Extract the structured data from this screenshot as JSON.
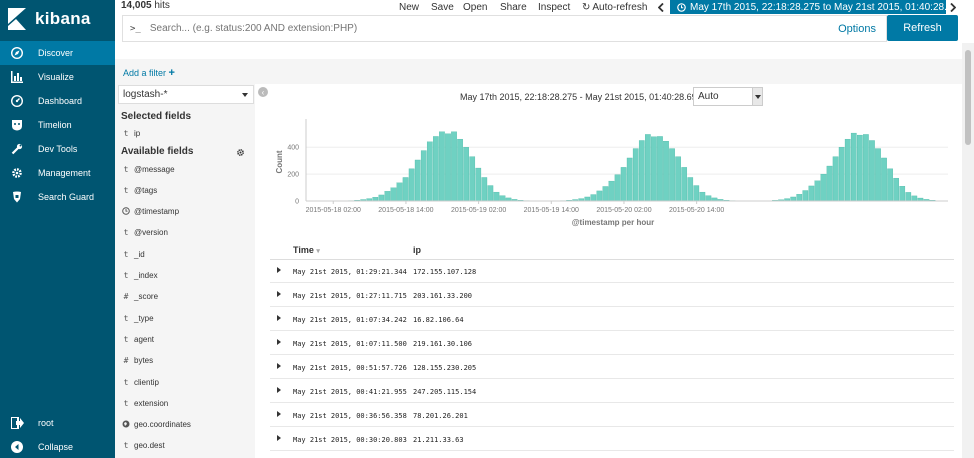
{
  "app": {
    "name": "kibana"
  },
  "colors": {
    "sidebar": "#005571",
    "accent": "#0079a5",
    "bar": "#6fd1c2"
  },
  "sidebar": {
    "items": [
      {
        "label": "Discover",
        "icon": "compass-icon",
        "active": true
      },
      {
        "label": "Visualize",
        "icon": "bar-chart-icon"
      },
      {
        "label": "Dashboard",
        "icon": "dashboard-icon"
      },
      {
        "label": "Timelion",
        "icon": "timelion-icon"
      },
      {
        "label": "Dev Tools",
        "icon": "wrench-icon"
      },
      {
        "label": "Management",
        "icon": "gear-icon"
      },
      {
        "label": "Search Guard",
        "icon": "search-guard-icon"
      }
    ],
    "bottom": [
      {
        "label": "root",
        "icon": "logout-icon"
      },
      {
        "label": "Collapse",
        "icon": "collapse-icon"
      }
    ]
  },
  "topbar": {
    "hits_count": "14,005",
    "hits_label": " hits",
    "menu": {
      "new": "New",
      "save": "Save",
      "open": "Open",
      "share": "Share",
      "inspect": "Inspect",
      "auto_refresh": "Auto-refresh"
    },
    "time_range": "May 17th 2015, 22:18:28.275 to May 21st 2015, 01:40:28.697"
  },
  "query": {
    "prompt": ">_",
    "placeholder": "Search... (e.g. status:200 AND extension:PHP)",
    "options": "Options",
    "refresh": "Refresh"
  },
  "filters": {
    "add": "Add a filter"
  },
  "fields": {
    "index_pattern": "logstash-*",
    "selected_title": "Selected fields",
    "selected": [
      {
        "type": "t",
        "name": "ip"
      }
    ],
    "available_title": "Available fields",
    "available": [
      {
        "type": "t",
        "name": "@message"
      },
      {
        "type": "t",
        "name": "@tags"
      },
      {
        "type": "clock",
        "name": "@timestamp"
      },
      {
        "type": "t",
        "name": "@version"
      },
      {
        "type": "t",
        "name": "_id"
      },
      {
        "type": "t",
        "name": "_index"
      },
      {
        "type": "#",
        "name": "_score"
      },
      {
        "type": "t",
        "name": "_type"
      },
      {
        "type": "t",
        "name": "agent"
      },
      {
        "type": "#",
        "name": "bytes"
      },
      {
        "type": "t",
        "name": "clientip"
      },
      {
        "type": "t",
        "name": "extension"
      },
      {
        "type": "geo",
        "name": "geo.coordinates"
      },
      {
        "type": "t",
        "name": "geo.dest"
      }
    ]
  },
  "histogram": {
    "range_text": "May 17th 2015, 22:18:28.275 - May 21st 2015, 01:40:28.697 —",
    "interval": "Auto"
  },
  "chart_data": {
    "type": "bar",
    "xlabel": "@timestamp per hour",
    "ylabel": "Count",
    "ylim": [
      0,
      580
    ],
    "yticks": [
      0,
      200,
      400
    ],
    "xticks": [
      "2015-05-18 02:00",
      "2015-05-18 14:00",
      "2015-05-19 02:00",
      "2015-05-19 14:00",
      "2015-05-20 02:00",
      "2015-05-20 14:00"
    ],
    "xticks_hour_index": [
      4,
      16,
      28,
      40,
      52,
      64
    ],
    "values": [
      0,
      0,
      0,
      0,
      0,
      0,
      1,
      3,
      6,
      11,
      18,
      28,
      45,
      72,
      98,
      135,
      175,
      240,
      305,
      375,
      440,
      480,
      515,
      500,
      515,
      460,
      400,
      330,
      245,
      175,
      115,
      66,
      40,
      23,
      12,
      6,
      3,
      1,
      0,
      0,
      0,
      1,
      3,
      6,
      11,
      18,
      30,
      48,
      75,
      108,
      148,
      196,
      250,
      320,
      390,
      450,
      495,
      478,
      480,
      445,
      390,
      330,
      250,
      175,
      115,
      66,
      40,
      23,
      12,
      6,
      3,
      1,
      0,
      0,
      0,
      1,
      2,
      5,
      10,
      18,
      30,
      50,
      78,
      112,
      150,
      200,
      260,
      330,
      400,
      460,
      505,
      490,
      495,
      450,
      390,
      320,
      240,
      170,
      110,
      64,
      38,
      22,
      12,
      6,
      2,
      1
    ]
  },
  "table": {
    "columns": [
      "Time",
      "ip"
    ],
    "rows": [
      {
        "time": "May 21st 2015, 01:29:21.344",
        "ip": "172.155.107.128"
      },
      {
        "time": "May 21st 2015, 01:27:11.715",
        "ip": "203.161.33.200"
      },
      {
        "time": "May 21st 2015, 01:07:34.242",
        "ip": "16.82.106.64"
      },
      {
        "time": "May 21st 2015, 01:07:11.500",
        "ip": "219.161.30.106"
      },
      {
        "time": "May 21st 2015, 00:51:57.726",
        "ip": "128.155.230.205"
      },
      {
        "time": "May 21st 2015, 00:41:21.955",
        "ip": "247.205.115.154"
      },
      {
        "time": "May 21st 2015, 00:36:56.358",
        "ip": "78.201.26.201"
      },
      {
        "time": "May 21st 2015, 00:30:20.803",
        "ip": "21.211.33.63"
      }
    ]
  }
}
